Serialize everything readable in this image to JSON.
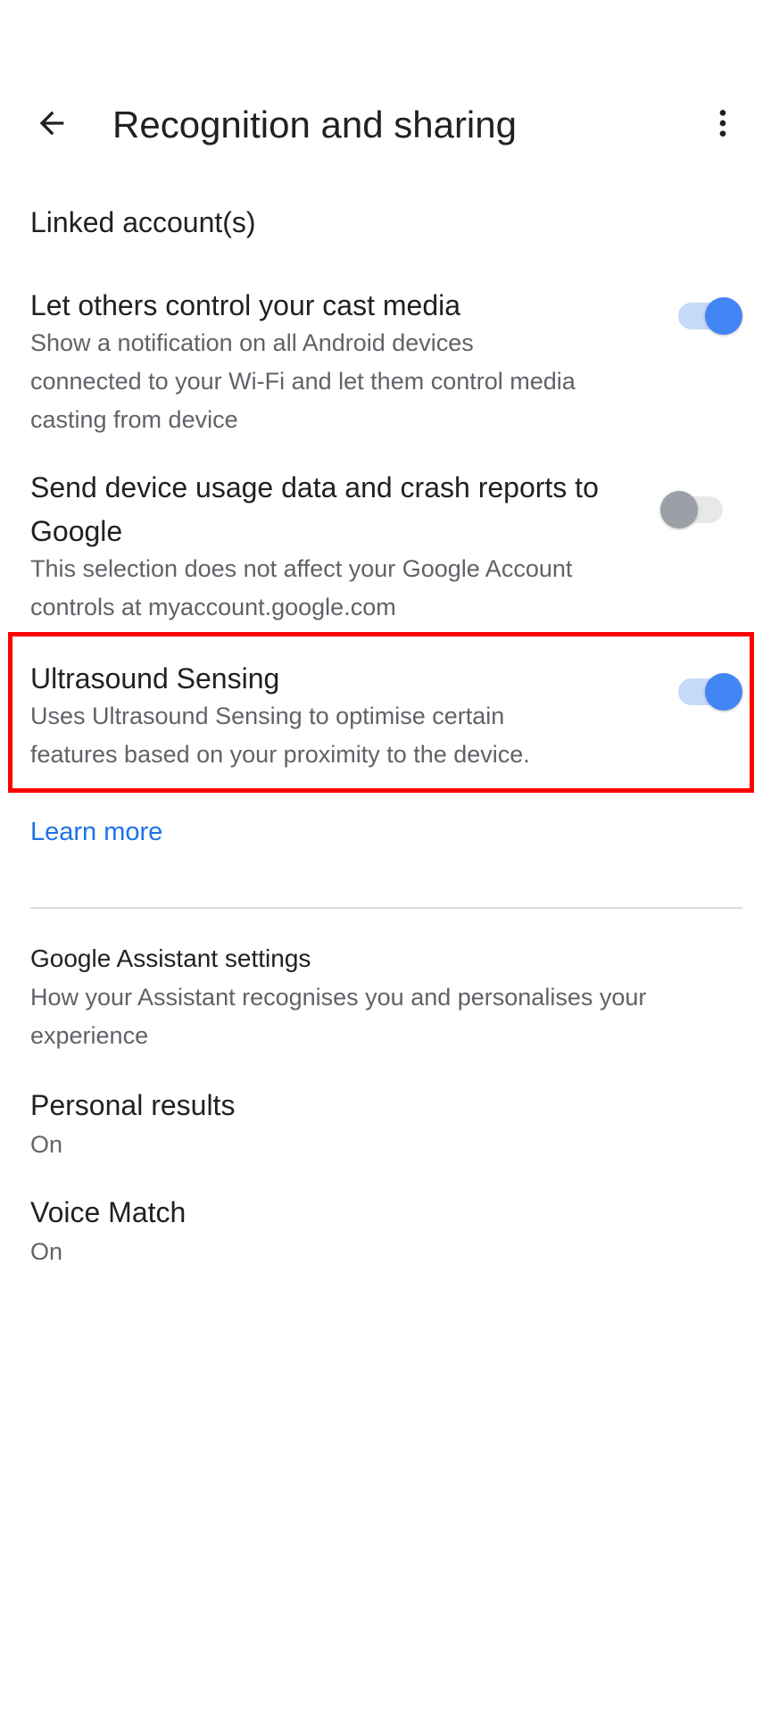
{
  "appbar": {
    "title": "Recognition and sharing",
    "back_icon": "arrow-back-icon",
    "more_icon": "more-vert-icon"
  },
  "linked_account": {
    "label": "Linked account(s)"
  },
  "settings": [
    {
      "label": "Let others control your cast media",
      "description": "Show a notification on all Android devices connected to your Wi-Fi and let them control media casting from device",
      "enabled": true
    },
    {
      "label": "Send device usage data and crash reports to Google",
      "description": "This selection does not affect your Google Account controls at myaccount.google.com",
      "enabled": false
    },
    {
      "label": "Ultrasound Sensing",
      "description": "Uses Ultrasound Sensing to optimise certain features based on your proximity to the device.",
      "enabled": true
    }
  ],
  "learn_more": "Learn more",
  "assistant_section": {
    "header": "Google Assistant settings",
    "description": "How your Assistant recognises you and personalises your experience",
    "items": [
      {
        "label": "Personal results",
        "value": "On"
      },
      {
        "label": "Voice Match",
        "value": "On"
      }
    ]
  },
  "colors": {
    "accent": "#4285f4",
    "link": "#1a73e8",
    "highlight": "#ff0000",
    "text_primary": "#202124",
    "text_secondary": "#5f6368"
  }
}
